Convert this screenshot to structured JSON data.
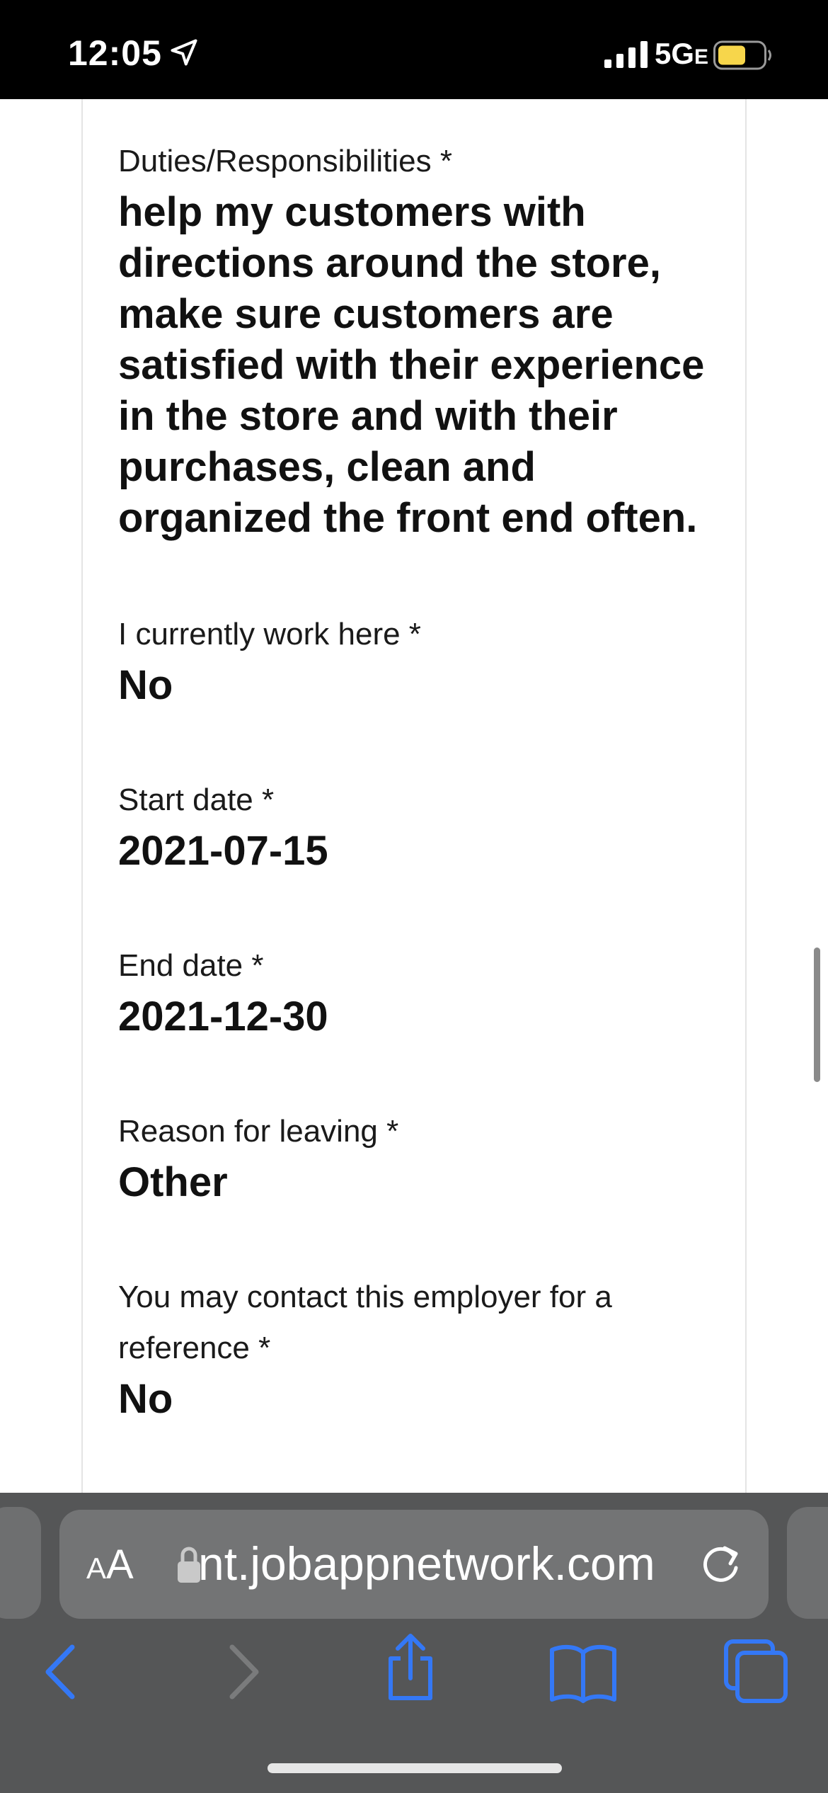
{
  "status_bar": {
    "time": "12:05",
    "network": "5G",
    "network_suffix": "E",
    "battery_color": "#f7d64b"
  },
  "fields": [
    {
      "label": "Duties/Responsibilities *",
      "value": "help my customers with directions around the store, make sure customers are satisfied with their experience in the store and with their purchases, clean and organized the front end often."
    },
    {
      "label": "I currently work here *",
      "value": "No"
    },
    {
      "label": "Start date *",
      "value": "2021-07-15"
    },
    {
      "label": "End date *",
      "value": "2021-12-30"
    },
    {
      "label": "Reason for leaving *",
      "value": "Other"
    },
    {
      "label": "You may contact this employer for a reference *",
      "value": "No"
    }
  ],
  "browser": {
    "text_size_big": "A",
    "text_size_small": "A",
    "url": "nt.jobappnetwork.com",
    "icons": [
      "back-icon",
      "forward-icon",
      "share-icon",
      "bookmarks-icon",
      "tabs-icon",
      "reload-icon",
      "lock-icon"
    ],
    "accent_color": "#3478f6"
  }
}
